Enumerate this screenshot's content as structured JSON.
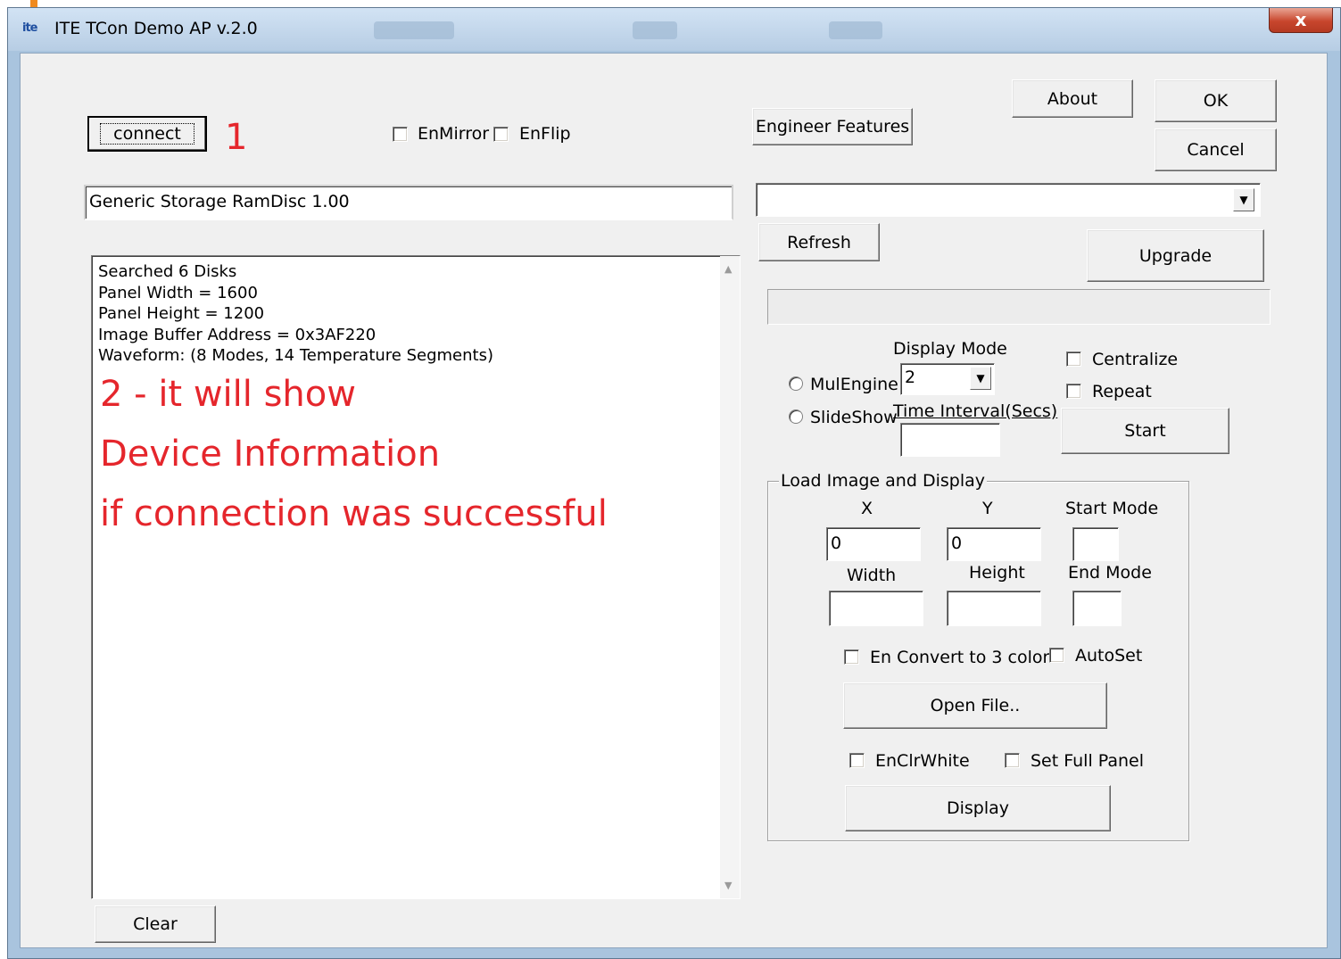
{
  "window": {
    "title": "ITE TCon Demo AP v.2.0",
    "app_icon_text": "ite",
    "close_symbol": "x"
  },
  "toolbar": {
    "connect_label": "connect",
    "about_label": "About",
    "ok_label": "OK",
    "cancel_label": "Cancel",
    "engineer_label": "Engineer Features",
    "refresh_label": "Refresh",
    "upgrade_label": "Upgrade",
    "clear_label": "Clear",
    "enmirror_label": "EnMirror",
    "enflip_label": "EnFlip"
  },
  "device": {
    "name_value": "Generic Storage RamDisc 1.00",
    "dropdown_value": ""
  },
  "log": {
    "lines": [
      "Searched 6 Disks",
      "Panel Width = 1600",
      "Panel Height = 1200",
      "Image Buffer Address = 0x3AF220",
      "Waveform: (8 Modes, 14 Temperature Segments)"
    ]
  },
  "annotations": {
    "step1": "1",
    "step2_line1": "2 - it will show",
    "step2_line2": "Device Information",
    "step2_line3": "if connection was  successful"
  },
  "display_mode": {
    "label": "Display Mode",
    "value": "2",
    "mulengine_label": "MulEngine",
    "slideshow_label": "SlideShow",
    "time_interval_label": "Time Interval(Secs)",
    "time_interval_value": "",
    "centralize_label": "Centralize",
    "repeat_label": "Repeat",
    "start_label": "Start"
  },
  "load_image": {
    "group_title": "Load Image and Display",
    "x_label": "X",
    "y_label": "Y",
    "start_mode_label": "Start Mode",
    "x_value": "0",
    "y_value": "0",
    "start_mode_value": "",
    "width_label": "Width",
    "height_label": "Height",
    "end_mode_label": "End Mode",
    "width_value": "",
    "height_value": "",
    "end_mode_value": "",
    "convert_label": "En Convert to 3 color",
    "autoset_label": "AutoSet",
    "open_file_label": "Open File..",
    "enclrwhite_label": "EnClrWhite",
    "set_full_panel_label": "Set Full Panel",
    "display_label": "Display"
  },
  "colors": {
    "annotation": "#e5262c",
    "title_bar": "#b7cde4",
    "client_bg": "#f0f0f0"
  }
}
